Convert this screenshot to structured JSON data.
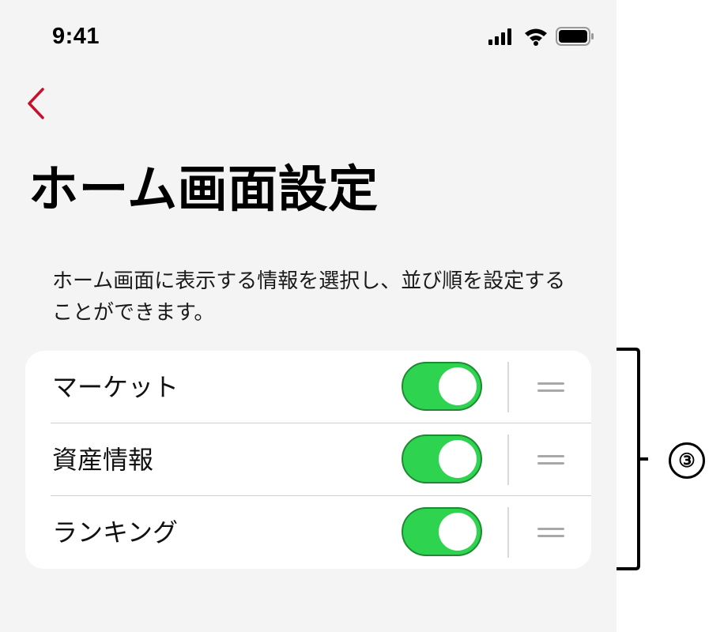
{
  "status_bar": {
    "time": "9:41"
  },
  "navigation": {
    "back_icon": "chevron-left-icon",
    "accent_color": "#c8102e"
  },
  "page": {
    "title": "ホーム画面設定",
    "description": "ホーム画面に表示する情報を選択し、並び順を設定することができます。"
  },
  "settings": {
    "items": [
      {
        "label": "マーケット",
        "enabled": true,
        "handle_icon": "drag-handle-icon"
      },
      {
        "label": "資産情報",
        "enabled": true,
        "handle_icon": "drag-handle-icon"
      },
      {
        "label": "ランキング",
        "enabled": true,
        "handle_icon": "drag-handle-icon"
      }
    ],
    "toggle_on_color": "#2ed350"
  },
  "annotation": {
    "callout_number": "③"
  }
}
